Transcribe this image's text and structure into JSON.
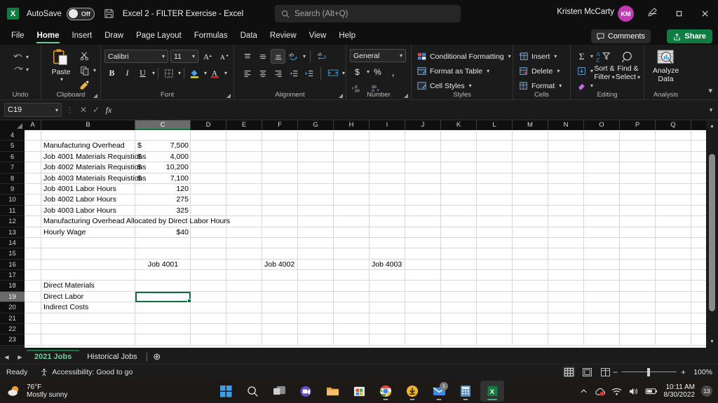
{
  "titlebar": {
    "app_icon": "excel-icon",
    "autosave_label": "AutoSave",
    "autosave_state": "Off",
    "save_icon": "save-icon",
    "document_title": "Excel 2 - FILTER Exercise  -  Excel",
    "search_placeholder": "Search (Alt+Q)",
    "search_icon": "search-icon",
    "user_name": "Kristen McCarty",
    "user_initials": "KM",
    "pen_icon": "pen-icon",
    "minimize_label": "—",
    "restore_label": "❐",
    "close_label": "✕"
  },
  "ribbon_tabs": {
    "items": [
      {
        "label": "File",
        "active": false
      },
      {
        "label": "Home",
        "active": true
      },
      {
        "label": "Insert",
        "active": false
      },
      {
        "label": "Draw",
        "active": false
      },
      {
        "label": "Page Layout",
        "active": false
      },
      {
        "label": "Formulas",
        "active": false
      },
      {
        "label": "Data",
        "active": false
      },
      {
        "label": "Review",
        "active": false
      },
      {
        "label": "View",
        "active": false
      },
      {
        "label": "Help",
        "active": false
      }
    ],
    "comments_label": "Comments",
    "share_label": "Share",
    "accent_green": "#107c41",
    "active_underline": "#6fce98"
  },
  "ribbon": {
    "undo": {
      "group_label": "Undo",
      "undo_label": "Undo",
      "redo_label": "Redo"
    },
    "clipboard": {
      "group_label": "Clipboard",
      "paste_label": "Paste",
      "cut_label": "Cut",
      "copy_label": "Copy",
      "format_painter_label": "Format Painter"
    },
    "font": {
      "group_label": "Font",
      "font_name": "Calibri",
      "font_size": "11",
      "grow_label": "A",
      "shrink_label": "A",
      "bold_label": "B",
      "italic_label": "I",
      "underline_label": "U",
      "borders_label": "Borders",
      "fill_label": "A",
      "fontcolor_label": "A"
    },
    "alignment": {
      "group_label": "Alignment"
    },
    "number": {
      "group_label": "Number",
      "format_value": "General",
      "currency_label": "$",
      "percent_label": "%",
      "comma_label": ",",
      "increase_decimal": ".00",
      "decrease_decimal": ".00"
    },
    "styles": {
      "group_label": "Styles",
      "conditional_formatting": "Conditional Formatting",
      "format_as_table": "Format as Table",
      "cell_styles": "Cell Styles"
    },
    "cells": {
      "group_label": "Cells",
      "insert_label": "Insert",
      "delete_label": "Delete",
      "format_label": "Format"
    },
    "editing": {
      "group_label": "Editing",
      "autosum_label": "AutoSum",
      "fill_label": "Fill",
      "clear_label": "Clear",
      "sort_filter_label_1": "Sort &",
      "sort_filter_label_2": "Filter",
      "find_select_label_1": "Find &",
      "find_select_label_2": "Select"
    },
    "analysis": {
      "group_label": "Analysis",
      "analyze_label_1": "Analyze",
      "analyze_label_2": "Data"
    }
  },
  "formula_bar": {
    "name_box_value": "C19",
    "cancel_icon": "cancel-icon",
    "enter_icon": "enter-icon",
    "function_icon": "fx-icon",
    "formula_value": ""
  },
  "grid": {
    "columns": [
      "A",
      "B",
      "C",
      "D",
      "E",
      "F",
      "G",
      "H",
      "I",
      "J",
      "K",
      "L",
      "M",
      "N",
      "O",
      "P",
      "Q"
    ],
    "selected_column": "C",
    "selected_row": "19",
    "selected_cell": "C19",
    "rows": [
      {
        "num": "4",
        "cells": []
      },
      {
        "num": "5",
        "cells": [
          {
            "col": "B",
            "text": "Manufacturing Overhead",
            "align": "left"
          },
          {
            "col": "C",
            "text": "$",
            "align": "left"
          },
          {
            "col": "C",
            "text": "7,500",
            "align": "right"
          }
        ]
      },
      {
        "num": "6",
        "cells": [
          {
            "col": "B",
            "text": "Job 4001 Materials Requistions",
            "align": "left"
          },
          {
            "col": "C",
            "text": "$",
            "align": "left"
          },
          {
            "col": "C",
            "text": "4,000",
            "align": "right"
          }
        ]
      },
      {
        "num": "7",
        "cells": [
          {
            "col": "B",
            "text": "Job 4002 Materials Requistions",
            "align": "left"
          },
          {
            "col": "C",
            "text": "$",
            "align": "left"
          },
          {
            "col": "C",
            "text": "10,200",
            "align": "right"
          }
        ]
      },
      {
        "num": "8",
        "cells": [
          {
            "col": "B",
            "text": "Job 4003 Materials Requistions",
            "align": "left"
          },
          {
            "col": "C",
            "text": "$",
            "align": "left"
          },
          {
            "col": "C",
            "text": "7,100",
            "align": "right"
          }
        ]
      },
      {
        "num": "9",
        "cells": [
          {
            "col": "B",
            "text": "Job 4001 Labor Hours",
            "align": "left"
          },
          {
            "col": "C",
            "text": "120",
            "align": "right"
          }
        ]
      },
      {
        "num": "10",
        "cells": [
          {
            "col": "B",
            "text": "Job 4002 Labor Hours",
            "align": "left"
          },
          {
            "col": "C",
            "text": "275",
            "align": "right"
          }
        ]
      },
      {
        "num": "11",
        "cells": [
          {
            "col": "B",
            "text": "Job 4003 Labor Hours",
            "align": "left"
          },
          {
            "col": "C",
            "text": "325",
            "align": "right"
          }
        ]
      },
      {
        "num": "12",
        "cells": [
          {
            "col": "B",
            "text": "Manufacturing Overhead Allocated by Direct Labor Hours",
            "align": "left"
          }
        ]
      },
      {
        "num": "13",
        "cells": [
          {
            "col": "B",
            "text": "Hourly Wage",
            "align": "left"
          },
          {
            "col": "C",
            "text": "$40",
            "align": "right"
          }
        ]
      },
      {
        "num": "14",
        "cells": []
      },
      {
        "num": "15",
        "cells": []
      },
      {
        "num": "16",
        "cells": [
          {
            "col": "C",
            "text": "Job 4001",
            "align": "center"
          },
          {
            "col": "F",
            "text": "Job 4002",
            "align": "left"
          },
          {
            "col": "I",
            "text": "Job 4003",
            "align": "left"
          }
        ]
      },
      {
        "num": "17",
        "cells": []
      },
      {
        "num": "18",
        "cells": [
          {
            "col": "B",
            "text": "Direct Materials",
            "align": "left"
          }
        ]
      },
      {
        "num": "19",
        "cells": [
          {
            "col": "B",
            "text": "Direct Labor",
            "align": "left"
          }
        ]
      },
      {
        "num": "20",
        "cells": [
          {
            "col": "B",
            "text": "Indirect Costs",
            "align": "left"
          }
        ]
      },
      {
        "num": "21",
        "cells": []
      },
      {
        "num": "22",
        "cells": []
      },
      {
        "num": "23",
        "cells": []
      }
    ]
  },
  "sheet_tabs": {
    "prev_label": "◀",
    "next_label": "▶",
    "tabs": [
      {
        "label": "2021 Jobs",
        "active": true
      },
      {
        "label": "Historical Jobs",
        "active": false
      }
    ],
    "add_label": "⊕"
  },
  "status_bar": {
    "ready_label": "Ready",
    "accessibility_label": "Accessibility: Good to go",
    "accessibility_icon": "accessibility-icon",
    "view_normal_icon": "normal-view-icon",
    "view_pagelayout_icon": "page-layout-view-icon",
    "view_pagebreak_icon": "page-break-view-icon",
    "zoom_out_label": "−",
    "zoom_in_label": "+",
    "zoom_value": "100%"
  },
  "taskbar": {
    "weather_temp": "76°F",
    "weather_desc": "Mostly sunny",
    "weather_icon": "sun-cloud-icon",
    "icons": [
      {
        "name": "start-icon",
        "badge": "",
        "running": false,
        "active": false
      },
      {
        "name": "search-icon",
        "badge": "",
        "running": false,
        "active": false
      },
      {
        "name": "task-view-icon",
        "badge": "",
        "running": false,
        "active": false
      },
      {
        "name": "teams-icon",
        "badge": "",
        "running": false,
        "active": false
      },
      {
        "name": "file-explorer-icon",
        "badge": "",
        "running": false,
        "active": false
      },
      {
        "name": "microsoft-store-icon",
        "badge": "",
        "running": false,
        "active": false
      },
      {
        "name": "chrome-icon",
        "badge": "",
        "running": true,
        "active": false
      },
      {
        "name": "download-icon",
        "badge": "",
        "running": true,
        "active": false
      },
      {
        "name": "mail-icon",
        "badge": "1",
        "running": true,
        "active": false
      },
      {
        "name": "calculator-icon",
        "badge": "",
        "running": true,
        "active": false
      },
      {
        "name": "excel-icon",
        "badge": "",
        "running": true,
        "active": true
      }
    ],
    "tray": {
      "chevron_icon": "chevron-up-icon",
      "onedrive_icon": "onedrive-sync-icon",
      "wifi_icon": "wifi-icon",
      "volume_icon": "volume-icon",
      "battery_icon": "battery-icon",
      "time": "10:11 AM",
      "date": "8/30/2022",
      "notification_count": "13"
    }
  }
}
